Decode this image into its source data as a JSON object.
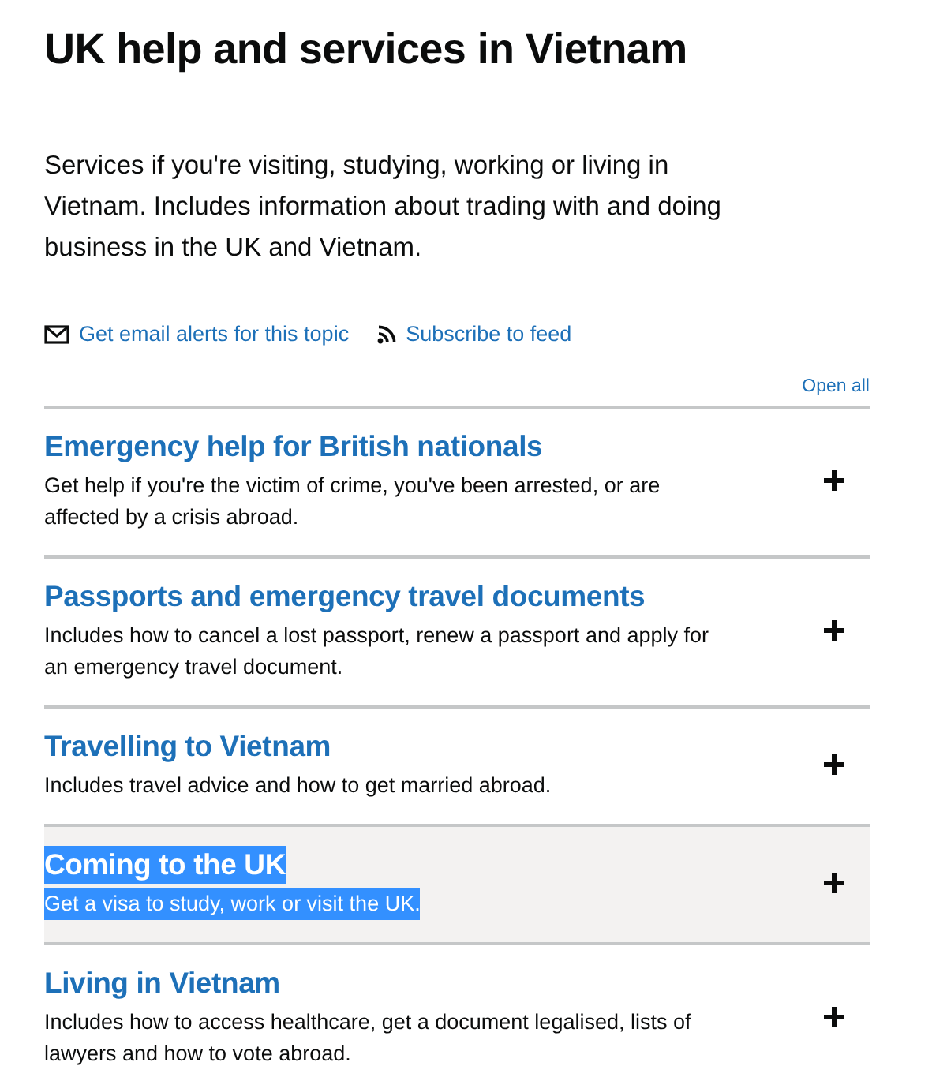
{
  "page": {
    "title": "UK help and services in Vietnam",
    "description": "Services if you're visiting, studying, working or living in Vietnam. Includes information about trading with and doing business in the UK and Vietnam."
  },
  "subscription_links": [
    {
      "kind": "email",
      "label": "Get email alerts for this topic"
    },
    {
      "kind": "feed",
      "label": "Subscribe to feed"
    }
  ],
  "accordion": {
    "open_all": "Open all",
    "sections": [
      {
        "heading": "Emergency help for British nationals",
        "summary": "Get help if you're the victim of crime, you've been arrested, or are affected by a crisis abroad.",
        "expanded": false,
        "hovered": false,
        "text_selected": false
      },
      {
        "heading": "Passports and emergency travel documents",
        "summary": "Includes how to cancel a lost passport, renew a passport and apply for an emergency travel document.",
        "expanded": false,
        "hovered": false,
        "text_selected": false
      },
      {
        "heading": "Travelling to Vietnam",
        "summary": "Includes travel advice and how to get married abroad.",
        "expanded": false,
        "hovered": false,
        "text_selected": false
      },
      {
        "heading": "Coming to the UK",
        "summary": "Get a visa to study, work or visit the UK.",
        "expanded": false,
        "hovered": true,
        "text_selected": true
      },
      {
        "heading": "Living in Vietnam",
        "summary": "Includes how to access healthcare, get a document legalised, lists of lawyers and how to vote abroad.",
        "expanded": false,
        "hovered": false,
        "text_selected": false
      }
    ]
  }
}
